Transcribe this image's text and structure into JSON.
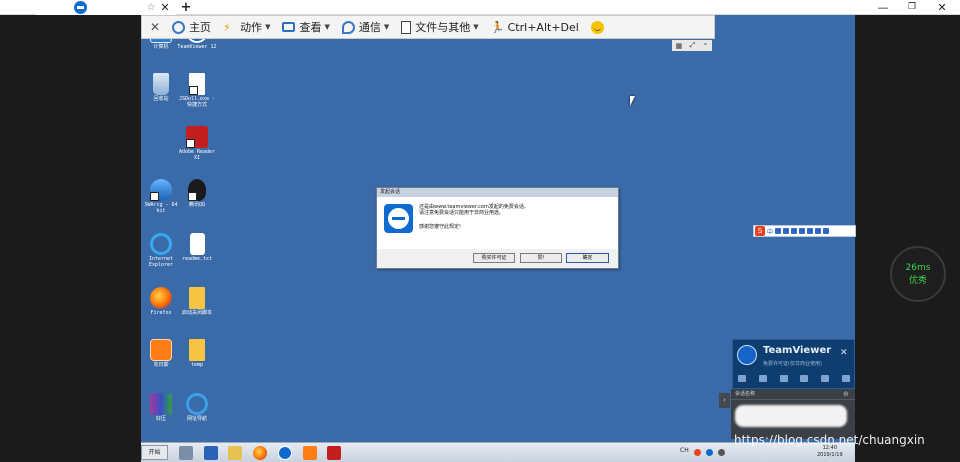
{
  "window": {
    "tab_close": "✕",
    "new_tab": "+",
    "minimize": "—",
    "maximize": "❐",
    "close": "✕"
  },
  "toolbar": {
    "items": [
      {
        "label": "主页",
        "icon": "home-icon"
      },
      {
        "label": "动作",
        "icon": "action-icon"
      },
      {
        "label": "查看",
        "icon": "view-icon"
      },
      {
        "label": "通信",
        "icon": "communicate-icon"
      },
      {
        "label": "文件与其他",
        "icon": "files-icon"
      },
      {
        "label": "Ctrl+Alt+Del",
        "icon": "ctrl-alt-del-icon"
      }
    ]
  },
  "desktop": {
    "icons": [
      {
        "label": "计算机"
      },
      {
        "label": "TeamViewer 12"
      },
      {
        "label": "回收站"
      },
      {
        "label": "JSDoll.exe - 快捷方式"
      },
      {
        "label": "Adobe Reader XI"
      },
      {
        "label": "SWArcg - 64 bit"
      },
      {
        "label": "腾讯QQ"
      },
      {
        "label": "Internet Explorer"
      },
      {
        "label": "readme.txt"
      },
      {
        "label": "Firefox"
      },
      {
        "label": "启动关闭脚本"
      },
      {
        "label": "向日葵"
      },
      {
        "label": "temp"
      },
      {
        "label": "好压"
      },
      {
        "label": "网址导航"
      }
    ]
  },
  "dialog": {
    "title": "发起会话",
    "line1": "还是由www.teamviewer.com发起的免费会话。",
    "line2": "请注意免费会话只能用于非商业用途。",
    "line3": "感谢您遵守此规定!",
    "buttons": {
      "buy": "购买许可证",
      "ok": "赞!",
      "confirm": "确定"
    }
  },
  "ime": {
    "mode": "中"
  },
  "tv_panel": {
    "title": "TeamViewer",
    "subtitle": "免费许可证(仅非商业使用)",
    "close": "✕"
  },
  "session": {
    "header": "会话名称"
  },
  "taskbar": {
    "start": "开始",
    "lang": "CH",
    "clock_time": "12:40",
    "clock_date": "2019/1/19"
  },
  "watermark": "https://blog.csdn.net/chuangxin",
  "ping": {
    "ms": "26ms",
    "label": "优秀"
  },
  "colors": {
    "desktop": "#3a6aa8",
    "teamviewer_blue": "#0f6ad0",
    "ping_green": "#39d24a"
  }
}
